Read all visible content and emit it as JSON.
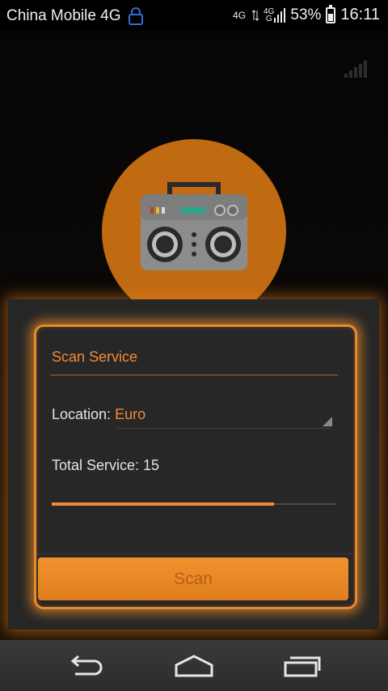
{
  "status_bar": {
    "carrier": "China Mobile 4G",
    "network_left": "4G",
    "network_small_top": "4G",
    "network_small_bottom": "G",
    "battery_percent": "53%",
    "battery_level": 0.53,
    "time": "16:11"
  },
  "app": {
    "icon": "radio-icon",
    "signal_icon": "signal-strength-icon"
  },
  "dialog": {
    "title": "Scan Service",
    "location_label": "Location: ",
    "location_value": "Euro",
    "total_service_label": "Total Service: 15",
    "progress": 0.78,
    "scan_button_label": "Scan"
  },
  "colors": {
    "accent": "#f08a3a",
    "circle": "#c06a12",
    "dialog_bg": "#272727"
  },
  "nav_bar": {
    "back": "back-icon",
    "home": "home-icon",
    "recents": "recents-icon"
  }
}
